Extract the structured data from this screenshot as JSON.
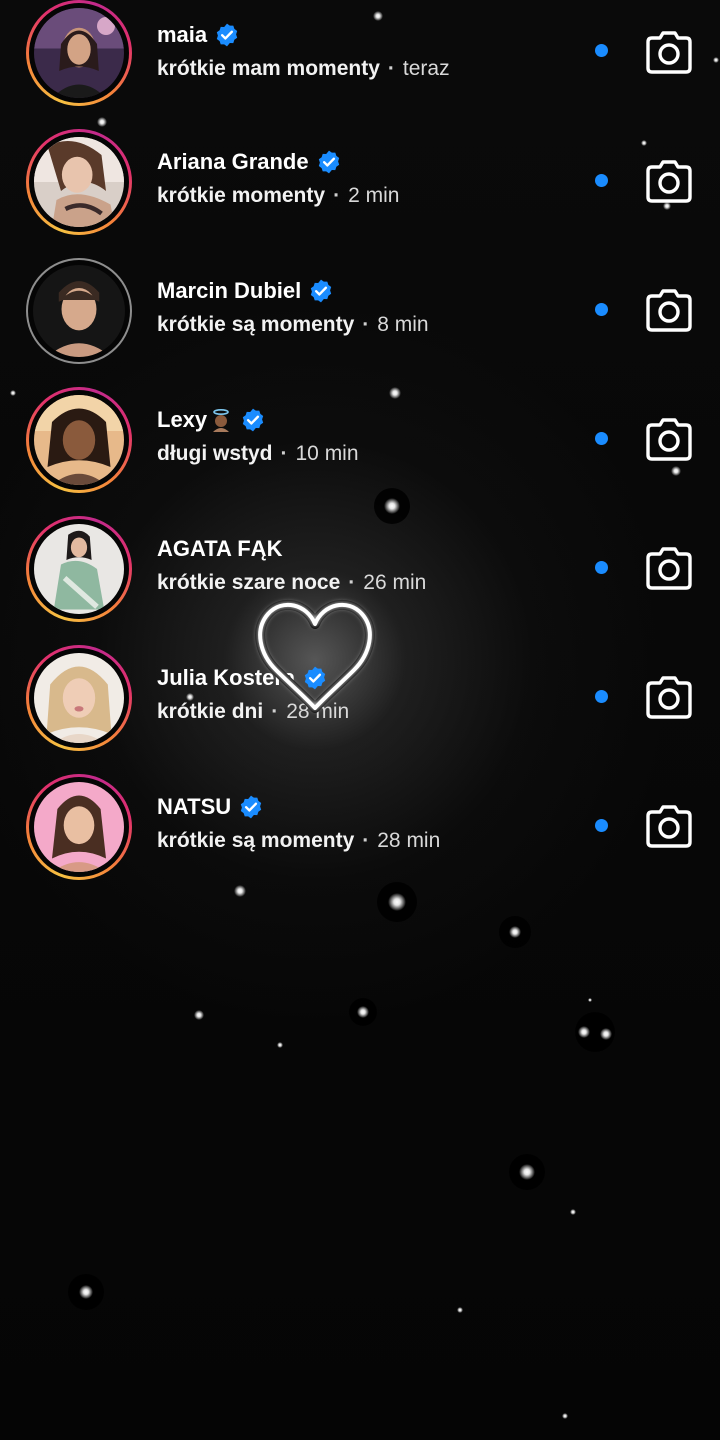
{
  "chats": [
    {
      "name": "maia",
      "verified": true,
      "preview": "krótkie mam momenty",
      "time": "teraz",
      "unread": true,
      "ring": "story"
    },
    {
      "name": "Ariana Grande",
      "verified": true,
      "preview": "krótkie momenty",
      "time": "2 min",
      "unread": true,
      "ring": "story"
    },
    {
      "name": "Marcin Dubiel",
      "verified": true,
      "preview": "krótkie są momenty",
      "time": "8 min",
      "unread": true,
      "ring": "seen"
    },
    {
      "name": "Lexy",
      "emoji": "angel-emoji",
      "verified": true,
      "preview": "długi wstyd",
      "time": "10 min",
      "unread": true,
      "ring": "story"
    },
    {
      "name": "AGATA FĄK",
      "verified": false,
      "preview": "krótkie szare noce",
      "time": "26 min",
      "unread": true,
      "ring": "story"
    },
    {
      "name": "Julia Kostera",
      "verified": true,
      "preview": "krótkie dni",
      "time": "28 min",
      "unread": true,
      "ring": "story"
    },
    {
      "name": "NATSU",
      "verified": true,
      "preview": "krótkie są momenty",
      "time": "28 min",
      "unread": true,
      "ring": "story"
    }
  ],
  "separator": "·",
  "icons": {
    "verified": "verified-badge-icon",
    "camera": "camera-icon",
    "unread": "unread-dot",
    "overlay": "heart-outline-icon"
  },
  "colors": {
    "background": "#050505",
    "verified": "#1a8cff",
    "unread_dot": "#1a8cff",
    "story_ring": [
      "#f6c142",
      "#f5813a",
      "#e1306c",
      "#c22a8c"
    ],
    "seen_ring": "#8e8e8e"
  }
}
